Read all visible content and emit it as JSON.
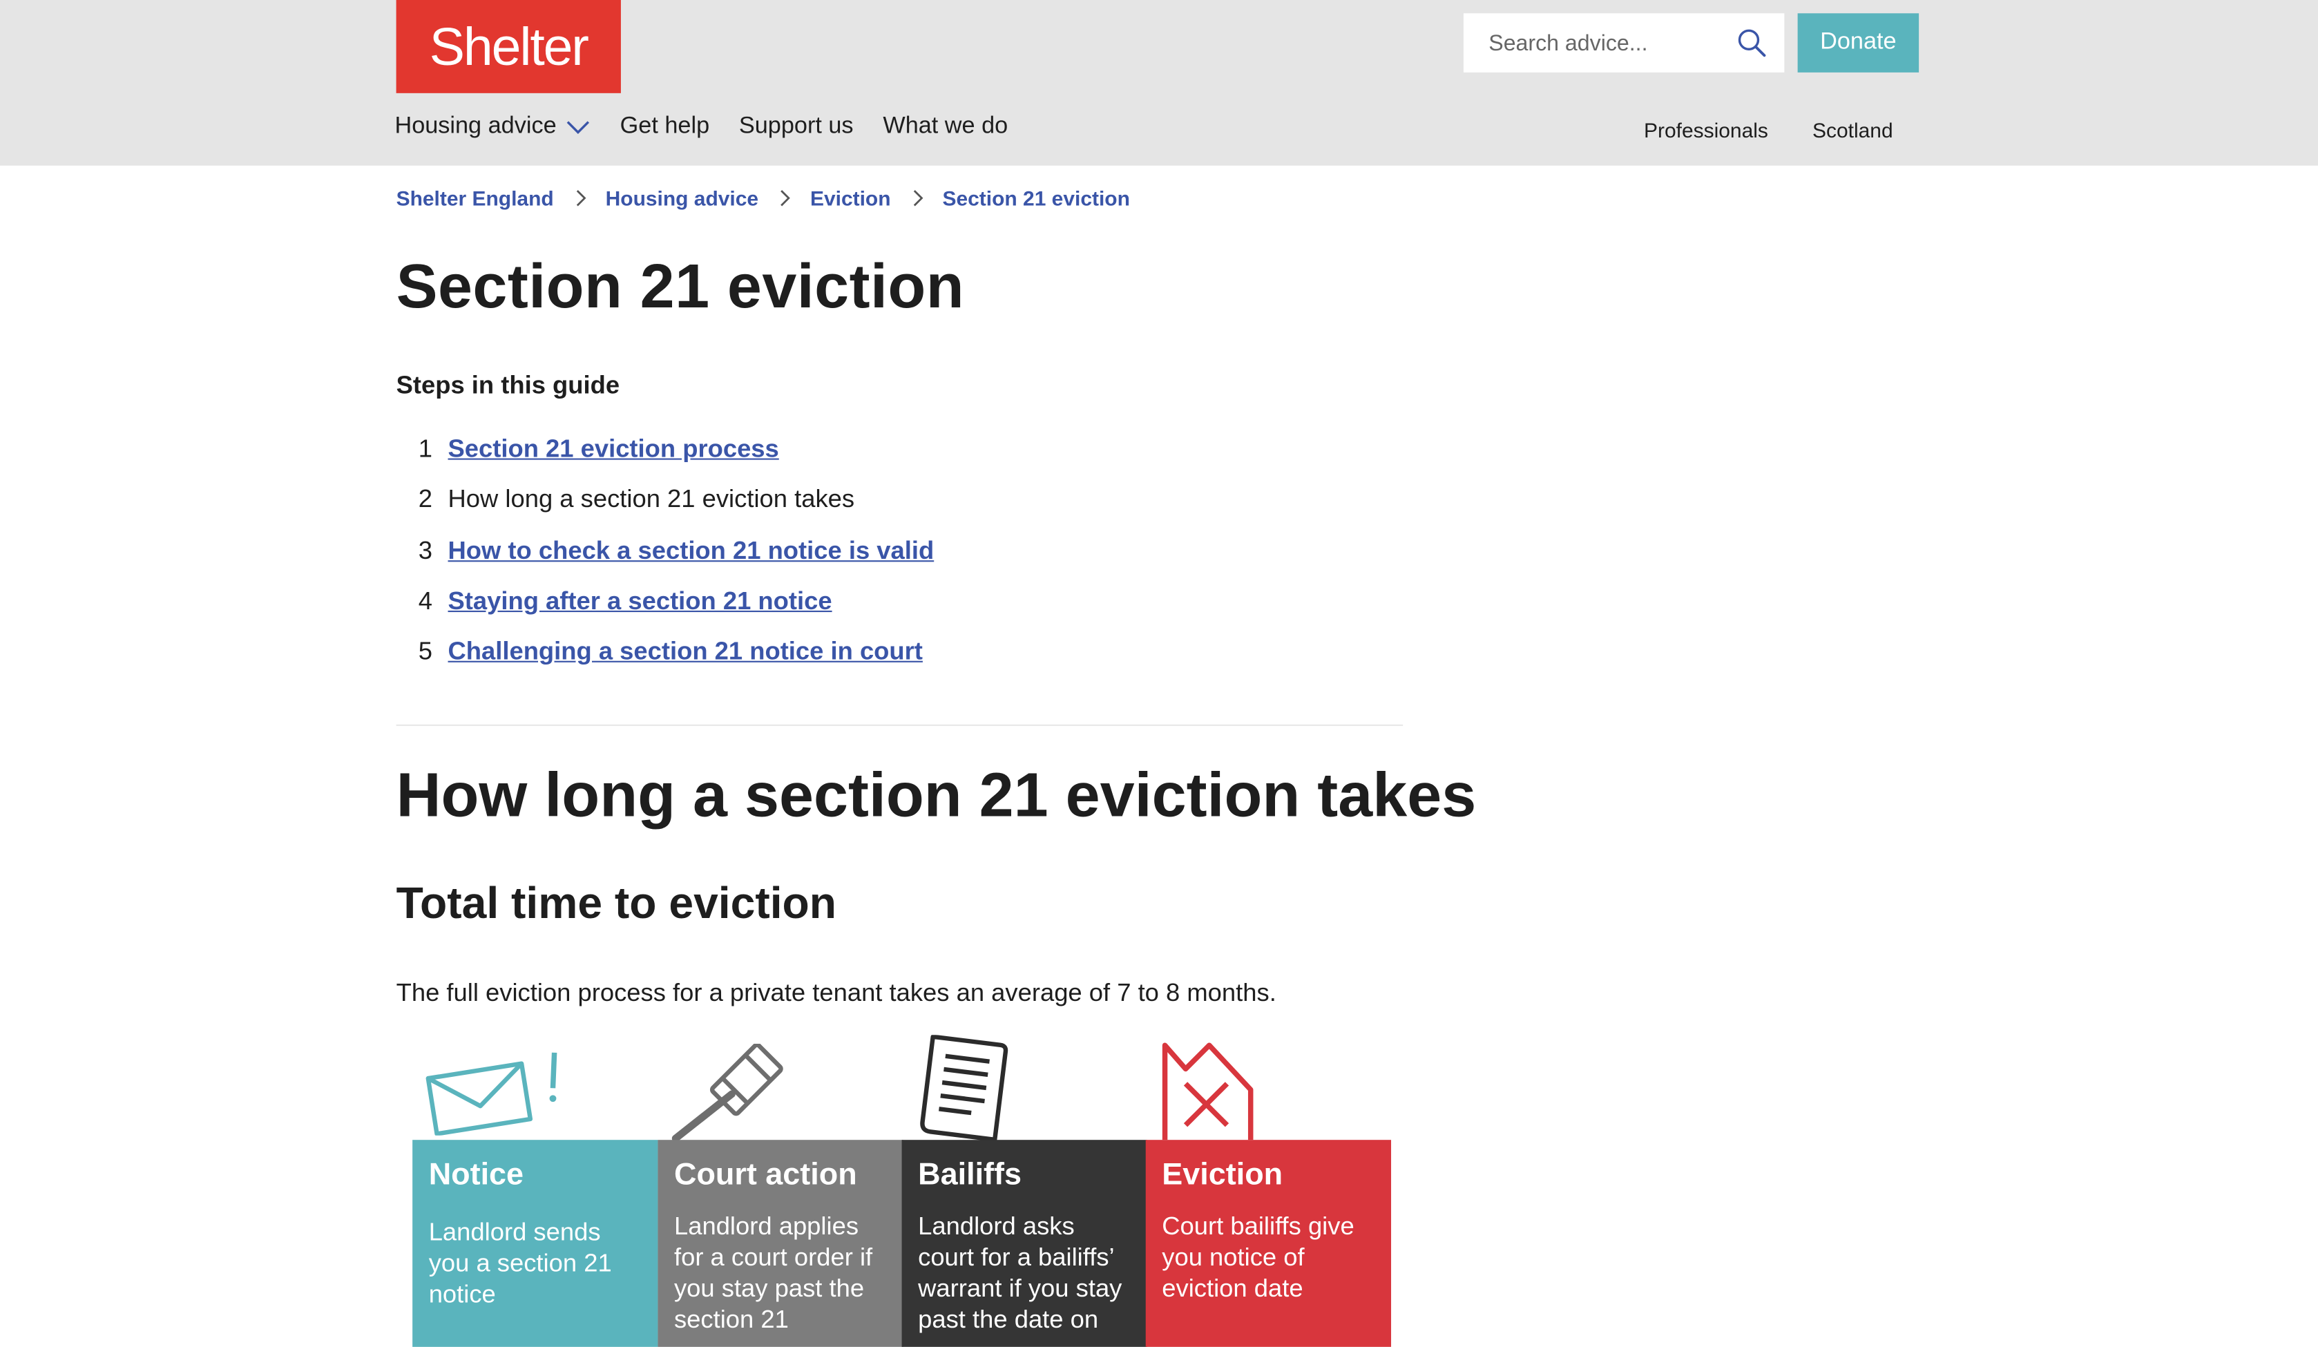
{
  "header": {
    "logo_text": "Shelter",
    "search_placeholder": "Search advice...",
    "donate_label": "Donate",
    "nav": [
      {
        "label": "Housing advice"
      },
      {
        "label": "Get help"
      },
      {
        "label": "Support us"
      },
      {
        "label": "What we do"
      }
    ],
    "secondary_nav": [
      {
        "label": "Professionals"
      },
      {
        "label": "Scotland"
      }
    ],
    "colors": {
      "brand": "#e2372f",
      "donate": "#5ab4bd",
      "bar": "#e5e5e5"
    }
  },
  "breadcrumb": [
    "Shelter England",
    "Housing advice",
    "Eviction",
    "Section 21 eviction"
  ],
  "page": {
    "title": "Section 21 eviction",
    "steps_heading": "Steps in this guide",
    "steps": [
      {
        "num": "1",
        "label": "Section 21 eviction process",
        "link": true
      },
      {
        "num": "2",
        "label": "How long a section 21 eviction takes",
        "link": false
      },
      {
        "num": "3",
        "label": "How to check a section 21 notice is valid",
        "link": true
      },
      {
        "num": "4",
        "label": "Staying after a section 21 notice",
        "link": true
      },
      {
        "num": "5",
        "label": "Challenging a section 21 notice in court",
        "link": true
      }
    ],
    "section_title": "How long a section 21 eviction takes",
    "subsection_title": "Total time to eviction",
    "intro": "The full eviction process for a private tenant takes an average of 7 to 8 months."
  },
  "infographic": {
    "stages": [
      {
        "title": "Notice",
        "text": "Landlord sends you a section 21 notice",
        "color": "#5ab4bd",
        "icon": "envelope-icon"
      },
      {
        "title": "Court action",
        "text": "Landlord applies for a court order if you stay past the section 21",
        "color": "#7d7d7d",
        "icon": "gavel-icon"
      },
      {
        "title": "Bailiffs",
        "text": "Landlord asks court for a bailiffs’ warrant if you stay past the date on",
        "color": "#353535",
        "icon": "document-icon"
      },
      {
        "title": "Eviction",
        "text": "Court bailiffs give you notice of eviction date",
        "color": "#d8363d",
        "icon": "house-cross-icon"
      }
    ]
  }
}
